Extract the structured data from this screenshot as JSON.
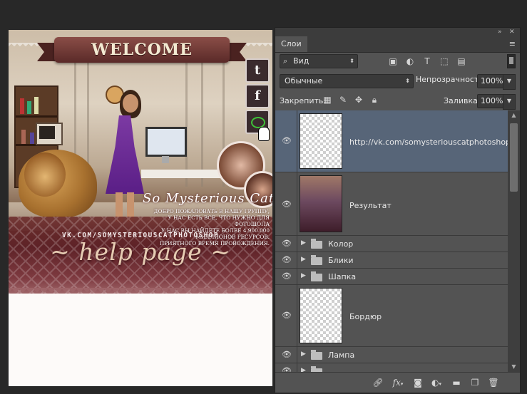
{
  "document": {
    "header": "WELCOME",
    "social": {
      "twitter": "t",
      "facebook": "f"
    },
    "signature": "So Mysterious Cat",
    "welcome_lines": [
      "ДОБРО ПОЖАЛОВАТЬ В НАШУ ГРУППУ,",
      "У НАС ЕСТЬ ВСЕ, ЧТО НУЖНО ДЛЯ ФОТОШОПА",
      "У НАС ВЫ НАЙДЕТЕ БОЛЕЕ 4.900.000 МИЛЛИОНОВ РЕСУРСОВ.",
      "ПРИЯТНОГО ВРЕМЯ ПРОВОЖДЕНИЯ."
    ],
    "url_line": "VK.COM/SOMYSTERIOUSCATPHOTOSHOP",
    "help_page": "~ help page ~"
  },
  "panel": {
    "tab": "Слои",
    "filter_kind": "Вид",
    "blend_mode": "Обычные",
    "opacity_label": "Непрозрачность:",
    "opacity": "100%",
    "lock_label": "Закрепить:",
    "fill_label": "Заливка:",
    "fill": "100%",
    "layers": [
      {
        "name": "http://vk.com/somysteriouscatphotoshop",
        "type": "layer",
        "selected": true
      },
      {
        "name": "Результат",
        "type": "image",
        "selected": false
      },
      {
        "name": "Колор",
        "type": "group",
        "selected": false
      },
      {
        "name": "Блики",
        "type": "group",
        "selected": false
      },
      {
        "name": "Шапка",
        "type": "group",
        "selected": false
      },
      {
        "name": "Бордюр",
        "type": "layer",
        "selected": false
      },
      {
        "name": "Лампа",
        "type": "group",
        "selected": false
      },
      {
        "name": "",
        "type": "group",
        "selected": false
      }
    ]
  }
}
